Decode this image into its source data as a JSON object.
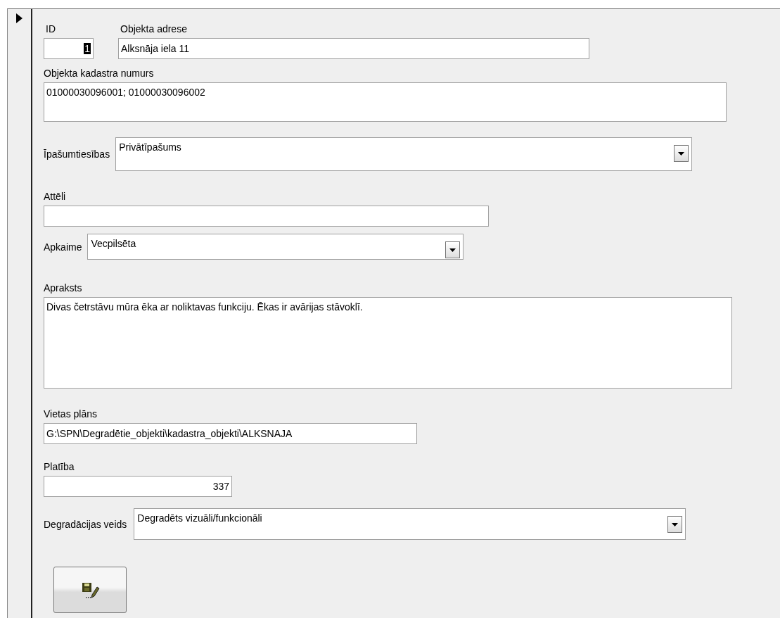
{
  "record_selector": {
    "current": true
  },
  "id": {
    "label": "ID",
    "value": "1",
    "focused": true
  },
  "address": {
    "label": "Objekta adrese",
    "value": "Alksnāja iela 11"
  },
  "cadastre": {
    "label": "Objekta kadastra numurs",
    "value": "01000030096001; 01000030096002"
  },
  "ownership": {
    "label": "Īpašumtiesības",
    "value": "Privātīpašums"
  },
  "images": {
    "label": "Attēli"
  },
  "neighbourhood": {
    "label": "Apkaime",
    "value": "Vecpilsēta"
  },
  "description": {
    "label": "Apraksts",
    "value": "Divas četrstāvu mūra ēka ar noliktavas funkciju. Ēkas ir avārijas stāvoklī."
  },
  "site_plan": {
    "label": "Vietas plāns",
    "value": "G:\\SPN\\Degradētie_objekti\\kadastra_objekti\\ALKSNAJA"
  },
  "area": {
    "label": "Platība",
    "value": "337"
  },
  "degradation": {
    "label": "Degradācijas veids",
    "value": "Degradēts vizuāli/funkcionāli"
  }
}
